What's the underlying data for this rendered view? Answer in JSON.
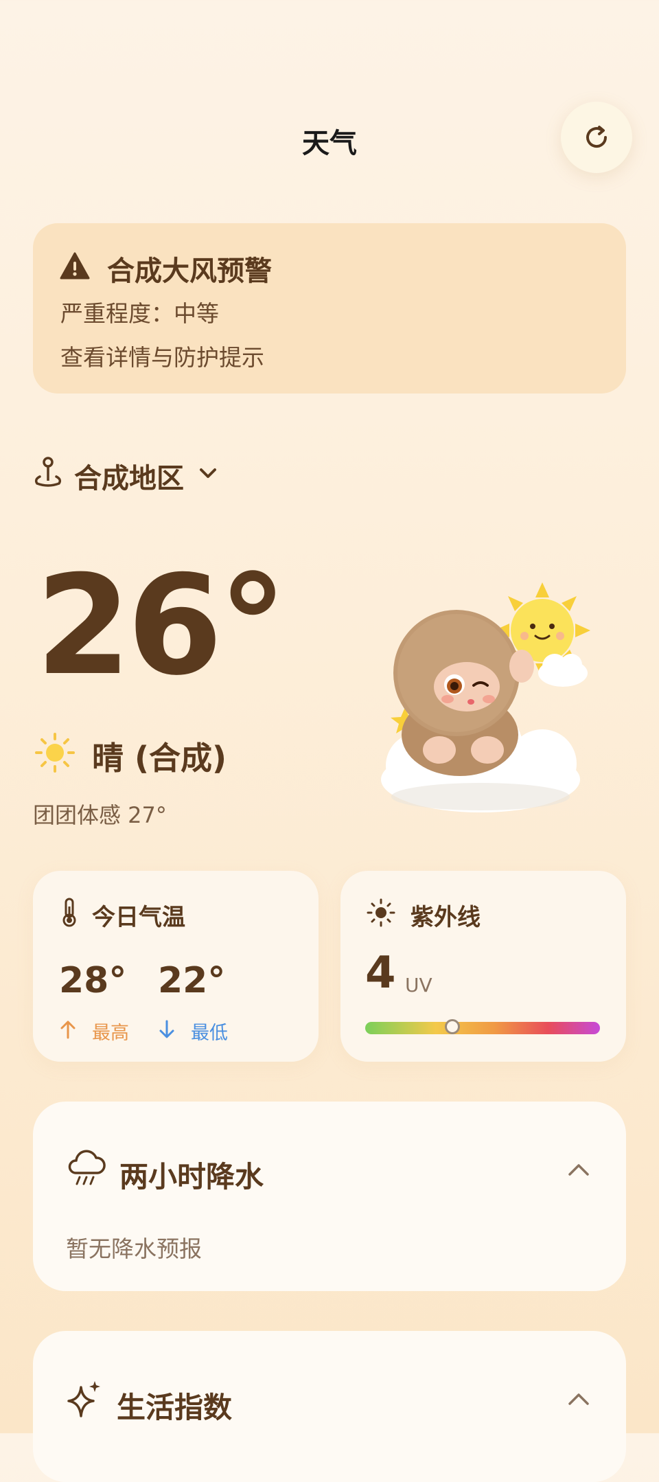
{
  "header": {
    "title": "天气",
    "refresh_icon": "refresh-icon"
  },
  "alert": {
    "title": "合成大风预警",
    "severity": "严重程度：中等",
    "link": "查看详情与防护提示",
    "icon": "warning-icon",
    "color": "#fae2c0"
  },
  "location": {
    "name": "合成地区",
    "icon": "location-pin-icon"
  },
  "current": {
    "temperature": "26°",
    "condition": "晴 (合成)",
    "feels_like": "团团体感 27°",
    "condition_icon": "sun-icon"
  },
  "temp_card": {
    "title": "今日气温",
    "high": "28°",
    "low": "22°",
    "high_label": "最高",
    "low_label": "最低",
    "high_color": "#e8954a",
    "low_color": "#4a8fe0"
  },
  "uv_card": {
    "title": "紫外线",
    "value": "4",
    "unit": "UV",
    "level_fraction": 0.37
  },
  "precip": {
    "title": "两小时降水",
    "text": "暂无降水预报"
  },
  "life": {
    "title": "生活指数"
  },
  "colors": {
    "text_brown": "#5a3a1e",
    "accent": "#fdf6ec"
  }
}
